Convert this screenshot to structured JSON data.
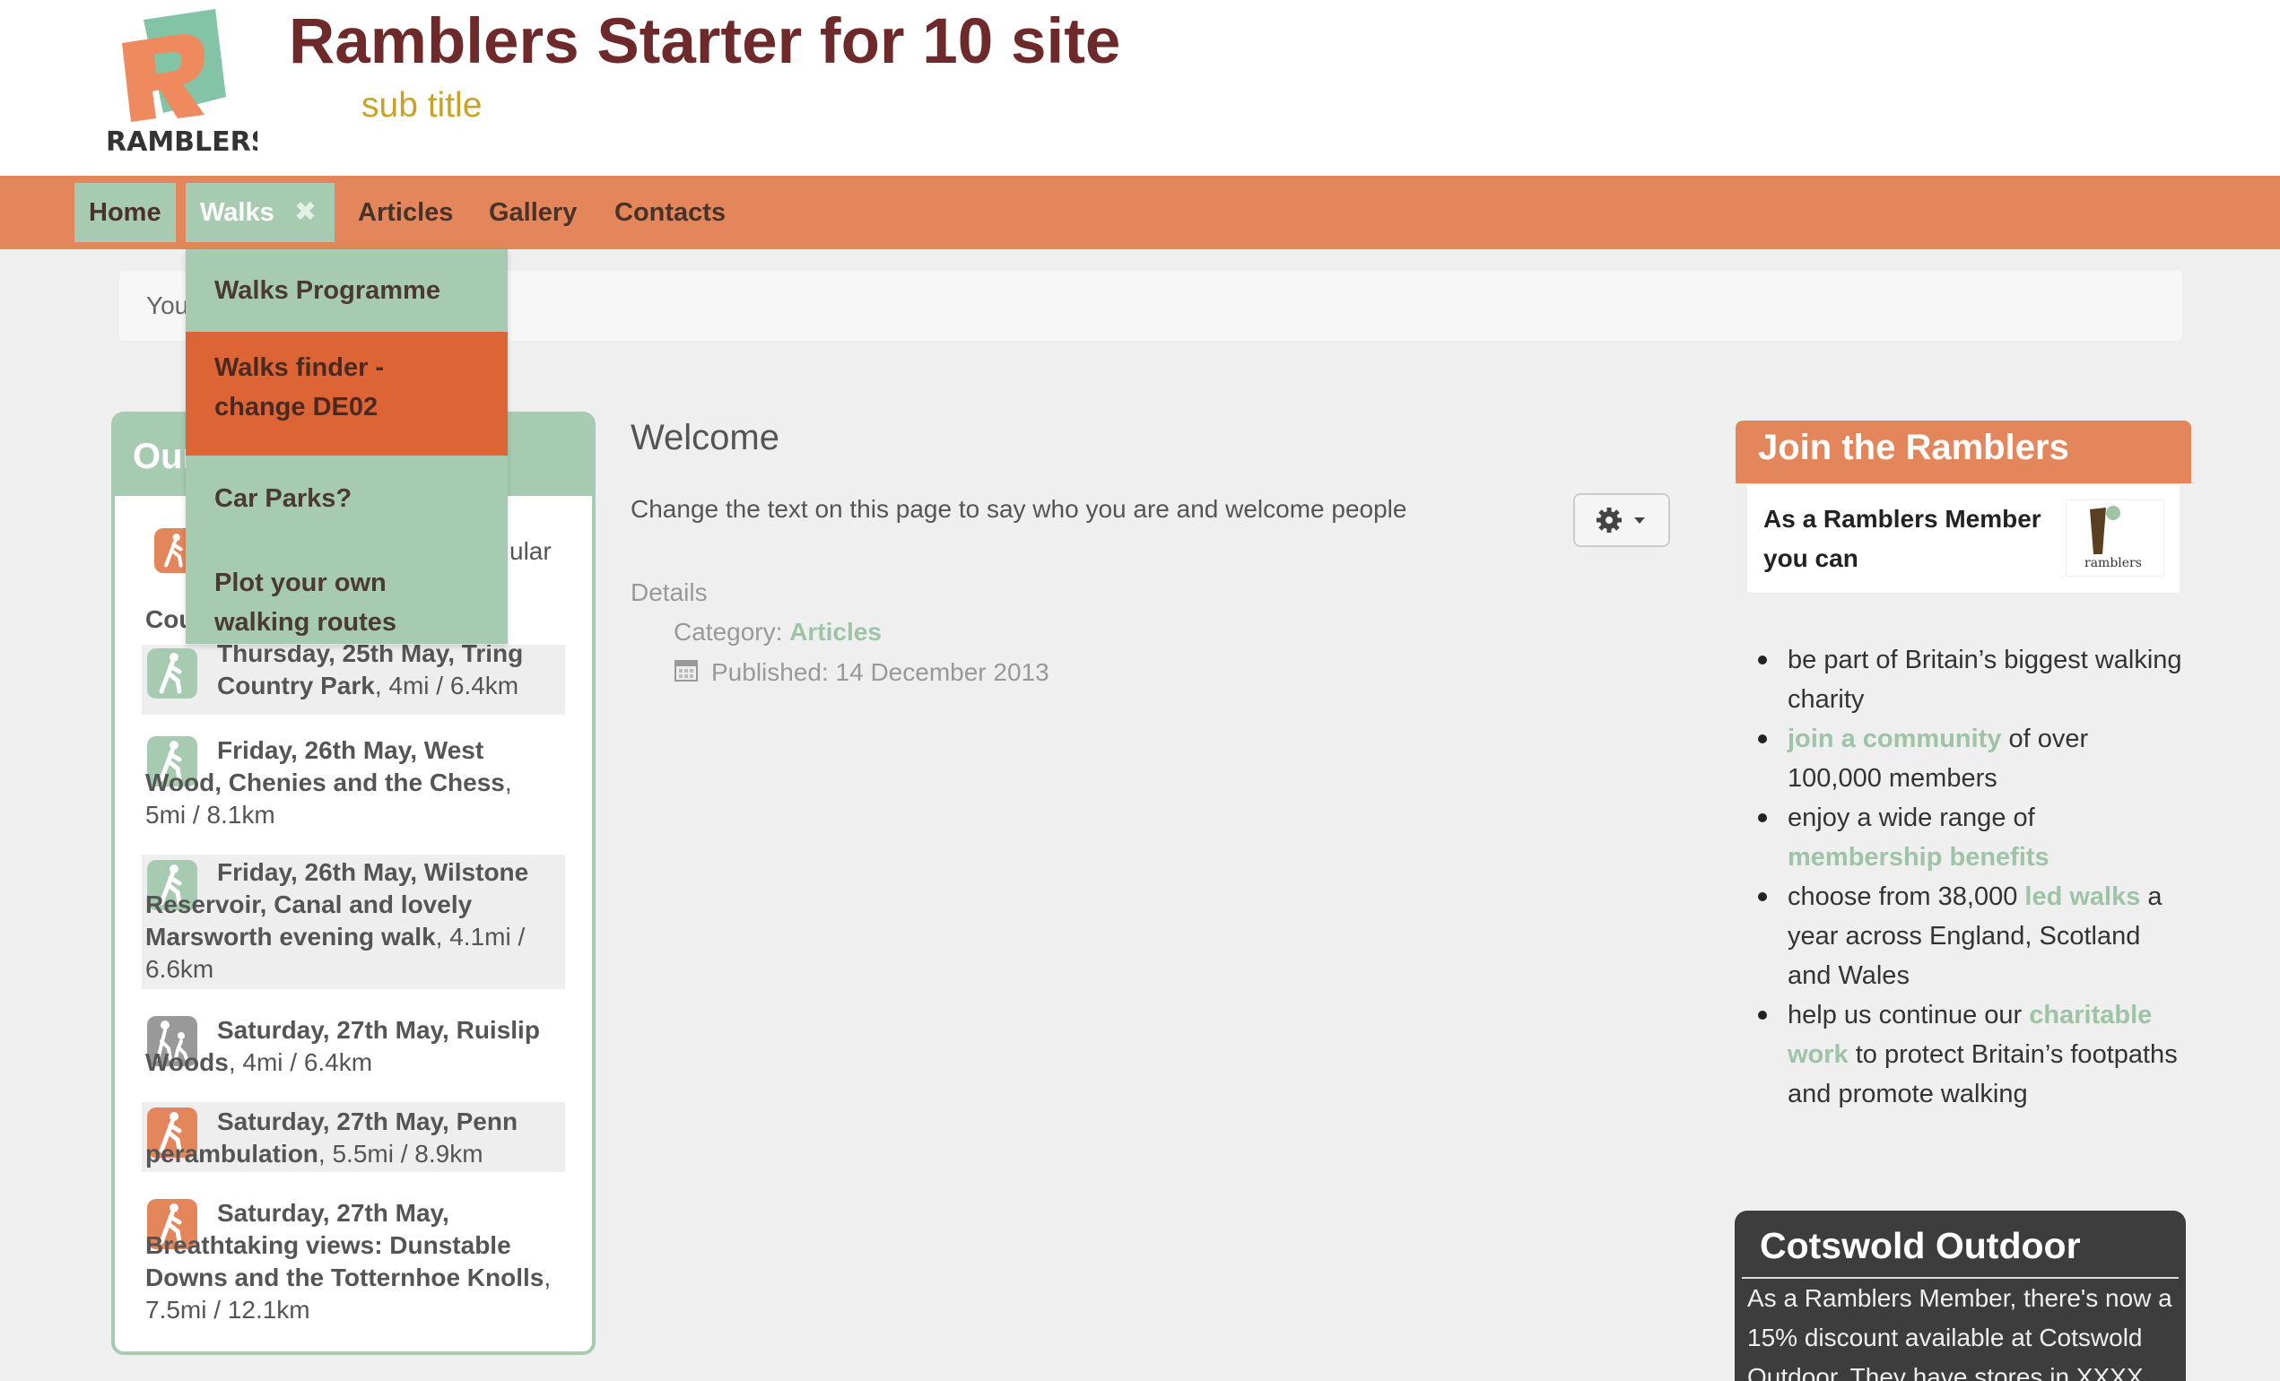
{
  "header": {
    "logo_text": "RAMBLERS",
    "site_title": "Ramblers Starter for 10 site",
    "sub_title": "sub title"
  },
  "nav": {
    "items": [
      {
        "label": "Home"
      },
      {
        "label": "Walks"
      },
      {
        "label": "Articles"
      },
      {
        "label": "Gallery"
      },
      {
        "label": "Contacts"
      }
    ],
    "walks_close_icon": "close-icon",
    "dropdown": [
      {
        "label": "Walks Programme"
      },
      {
        "label": "Walks finder - change DE02"
      },
      {
        "label": "Car Parks?"
      },
      {
        "label": "Plot your own walking routes"
      }
    ]
  },
  "breadcrumb": {
    "text": "You"
  },
  "left_module": {
    "title": "Our",
    "walks": [
      {
        "bold": "",
        "text": "ular",
        "icon": "walker-orange"
      },
      {
        "bold": "Cou",
        "text": "",
        "icon": ""
      },
      {
        "bold": "Thursday, 25th May, Tring Country Park",
        "text": ", 4mi / 6.4km",
        "icon": "walker-green"
      },
      {
        "bold": "Friday, 26th May, West Wood, Chenies and the Chess",
        "text": ", 5mi / 8.1km",
        "icon": "walker-green"
      },
      {
        "bold": "Friday, 26th May, Wilstone Reservoir, Canal and lovely Marsworth evening walk",
        "text": ", 4.1mi / 6.6km",
        "icon": "walker-green"
      },
      {
        "bold": "Saturday, 27th May, Ruislip Woods",
        "text": ", 4mi / 6.4km",
        "icon": "family-grey"
      },
      {
        "bold": "Saturday, 27th May, Penn perambulation",
        "text": ", 5.5mi / 8.9km",
        "icon": "walker-orange"
      },
      {
        "bold": "Saturday, 27th May, Breathtaking views: Dunstable Downs and the Totternhoe Knolls",
        "text": ", 7.5mi / 12.1km",
        "icon": "walker-orange"
      }
    ]
  },
  "main": {
    "title": "Welcome",
    "text": "Change the text on this page to say who you are and welcome people",
    "gear_icon": "gear-icon",
    "details_label": "Details",
    "category_prefix": "Category: ",
    "category_link": "Articles",
    "published": "Published: 14 December 2013"
  },
  "join": {
    "title": "Join the Ramblers",
    "box_text": "As a Ramblers Member you can",
    "logo_text": "ramblers",
    "list": [
      {
        "pre": "be part of Britain’s biggest walking charity",
        "link": "",
        "post": ""
      },
      {
        "pre": "",
        "link": "join a community",
        "post": " of over 100,000 members"
      },
      {
        "pre": "enjoy a wide range of ",
        "link": "membership benefits",
        "post": ""
      },
      {
        "pre": "choose from 38,000 ",
        "link": "led walks",
        "post": " a year across England, Scotland and Wales"
      },
      {
        "pre": "help us continue our ",
        "link": "charitable work",
        "post": " to protect Britain’s footpaths and promote walking"
      }
    ]
  },
  "cotswold": {
    "title": "Cotswold Outdoor",
    "text": "As a Ramblers Member, there's now a 15% discount available at Cotswold Outdoor. They have stores in XXXX"
  },
  "colors": {
    "navbar": "#e3865b",
    "nav_active": "#a7cbb1",
    "dropdown_highlight": "#dd6535",
    "title": "#6e2a2a",
    "subtitle": "#c9a227",
    "link": "#9ec3a6"
  }
}
